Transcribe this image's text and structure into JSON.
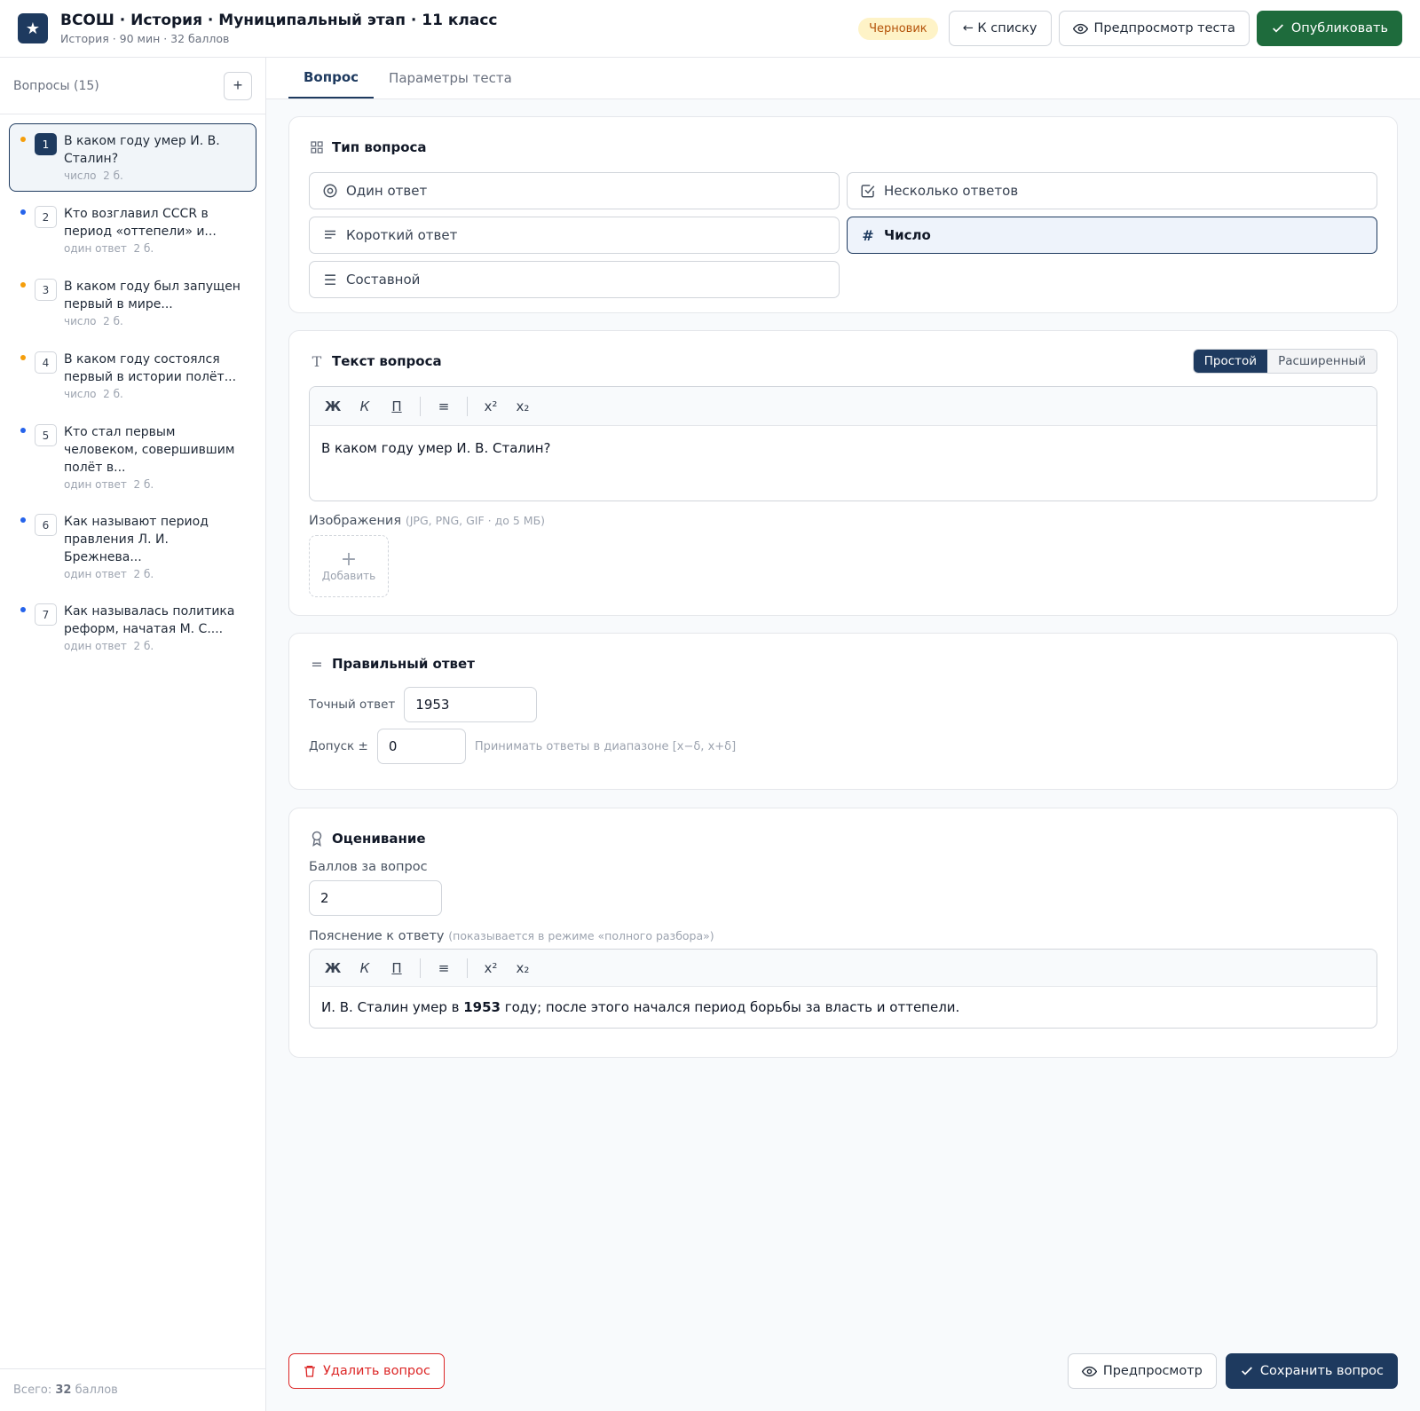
{
  "header": {
    "logo_glyph": "★",
    "title": "ВСОШ · История · Муниципальный этап · 11 класс",
    "subtitle": "История · 90 мин · 32 баллов",
    "status_badge": "Черновик",
    "back_label": "← К списку",
    "preview_label": "Предпросмотр теста",
    "publish_label": "Опубликовать"
  },
  "sidebar": {
    "title": "Вопросы (15)",
    "add_label": "+",
    "footer_prefix": "Всего:",
    "footer_value": "32",
    "footer_suffix": "баллов",
    "items": [
      {
        "num": "1",
        "text": "В каком году умер И. В. Сталин?",
        "type": "число",
        "points": "2 б.",
        "dot": "#f59e0b"
      },
      {
        "num": "2",
        "text": "Кто возглавил СССR в период «оттепели» и...",
        "type": "один ответ",
        "points": "2 б.",
        "dot": "#2563eb"
      },
      {
        "num": "3",
        "text": "В каком году был запущен первый в мире...",
        "type": "число",
        "points": "2 б.",
        "dot": "#f59e0b"
      },
      {
        "num": "4",
        "text": "В каком году состоялся первый в истории полёт...",
        "type": "число",
        "points": "2 б.",
        "dot": "#f59e0b"
      },
      {
        "num": "5",
        "text": "Кто стал первым человеком, совершившим полёт в...",
        "type": "один ответ",
        "points": "2 б.",
        "dot": "#2563eb"
      },
      {
        "num": "6",
        "text": "Как называют период правления Л. И. Брежнева...",
        "type": "один ответ",
        "points": "2 б.",
        "dot": "#2563eb"
      },
      {
        "num": "7",
        "text": "Как называлась политика реформ, начатая М. С....",
        "type": "один ответ",
        "points": "2 б.",
        "dot": "#2563eb"
      }
    ]
  },
  "tabs": {
    "question": "Вопрос",
    "params": "Параметры теста"
  },
  "type_card": {
    "title": "Тип вопроса",
    "one": "Один ответ",
    "multi": "Несколько ответов",
    "short": "Короткий ответ",
    "number": "Число",
    "compound": "Составной"
  },
  "text_card": {
    "title": "Текст вопроса",
    "mode_simple": "Простой",
    "mode_ext": "Расширенный",
    "body": "В каком году умер И. В. Сталин?",
    "images_label": "Изображения",
    "images_hint": "(JPG, PNG, GIF · до 5 МБ)",
    "add_image": "Добавить"
  },
  "toolbar": {
    "bold": "Ж",
    "italic": "К",
    "underline": "П",
    "list": "≡",
    "sup": "x²",
    "sub": "x₂"
  },
  "answer_card": {
    "title": "Правильный ответ",
    "exact_label": "Точный ответ",
    "exact_value": "1953",
    "tol_label": "Допуск ±",
    "tol_value": "0",
    "tol_hint": "Принимать ответы в диапазоне [x−δ, x+δ]"
  },
  "grading_card": {
    "title": "Оценивание",
    "points_label": "Баллов за вопрос",
    "points_value": "2",
    "explain_label": "Пояснение к ответу",
    "explain_hint": "(показывается в режиме «полного разбора»)",
    "explain_pre": "И. В. Сталин умер в",
    "explain_bold": "1953",
    "explain_post": "году; после этого начался период борьбы за власть и оттепели."
  },
  "footer": {
    "delete_label": "Удалить вопрос",
    "preview_label": "Предпросмотр",
    "save_label": "Сохранить вопрос"
  },
  "colors": {
    "accent": "#1e3a5f",
    "publish": "#1e6b3c",
    "danger": "#dc2626",
    "warning": "#f59e0b",
    "info": "#2563eb"
  }
}
